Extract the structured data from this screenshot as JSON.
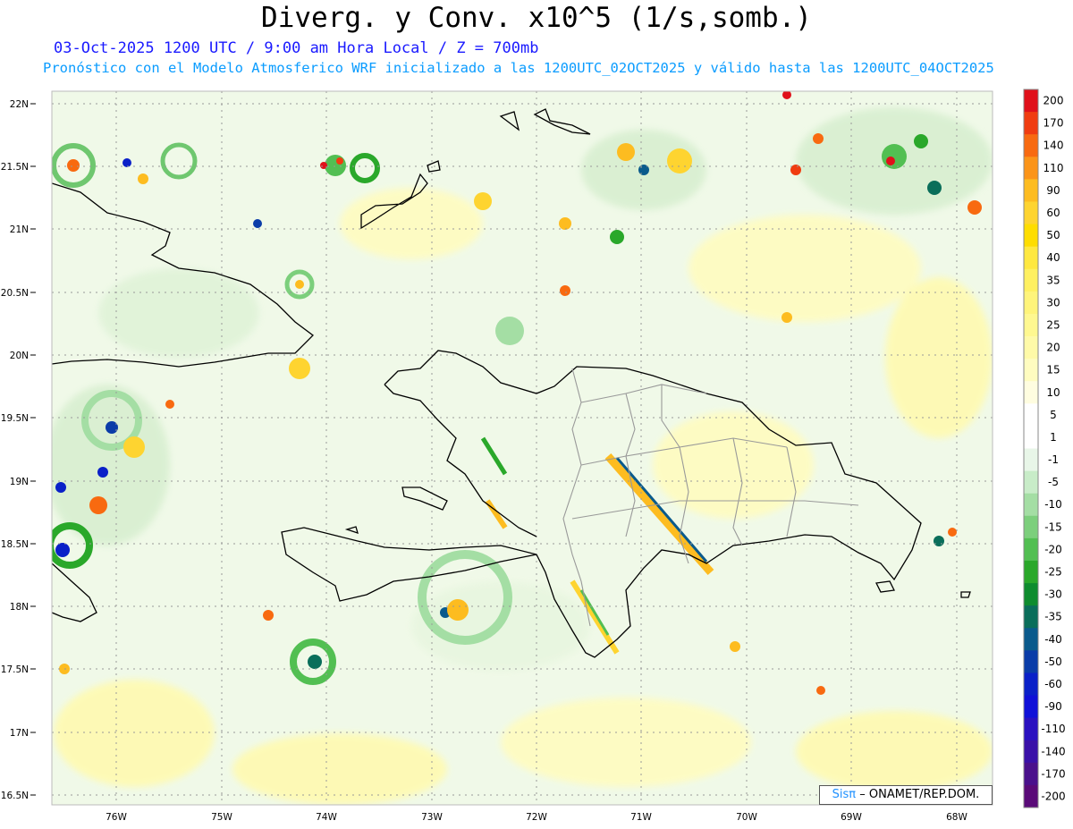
{
  "header": {
    "title": "Diverg. y Conv. x10^5 (1/s,somb.)",
    "line1": "03-Oct-2025  1200 UTC / 9:00 am Hora Local / Z = 700mb",
    "line2": "Pronóstico con el Modelo Atmosferico WRF inicializado a las 1200UTC_02OCT2025 y válido hasta las  1200UTC_04OCT2025"
  },
  "axes": {
    "lat_labels": [
      "22N",
      "21.5N",
      "21N",
      "20.5N",
      "20N",
      "19.5N",
      "19N",
      "18.5N",
      "18N",
      "17.5N",
      "17N",
      "16.5N"
    ],
    "lon_labels": [
      "76W",
      "75W",
      "74W",
      "73W",
      "72W",
      "71W",
      "70W",
      "69W",
      "68W"
    ]
  },
  "colorbar": {
    "labels": [
      "200",
      "170",
      "140",
      "110",
      "90",
      "60",
      "50",
      "40",
      "35",
      "30",
      "25",
      "20",
      "15",
      "10",
      "5",
      "1",
      "-1",
      "-5",
      "-10",
      "-15",
      "-20",
      "-25",
      "-30",
      "-35",
      "-40",
      "-50",
      "-60",
      "-90",
      "-110",
      "-140",
      "-170",
      "-200"
    ],
    "colors": [
      "#e0101a",
      "#f03c10",
      "#f86a10",
      "#fb9418",
      "#fdbc20",
      "#fed430",
      "#fedd00",
      "#ffe840",
      "#fff060",
      "#fff47a",
      "#fff890",
      "#fffaa8",
      "#fffcc0",
      "#fffde0",
      "#ffffff",
      "#ffffff",
      "#e8f6e8",
      "#c8ecc8",
      "#a4dea4",
      "#7ccf7c",
      "#52bf52",
      "#2aa82a",
      "#0e8c2e",
      "#0a6e5a",
      "#0a5a8c",
      "#0a3ca8",
      "#0a20c8",
      "#1010d8",
      "#2a10c0",
      "#3a10a8",
      "#4a108c",
      "#5a0a78"
    ]
  },
  "credit": {
    "sis": "Sisπ",
    "rest": "– ONAMET/REP.DOM."
  }
}
